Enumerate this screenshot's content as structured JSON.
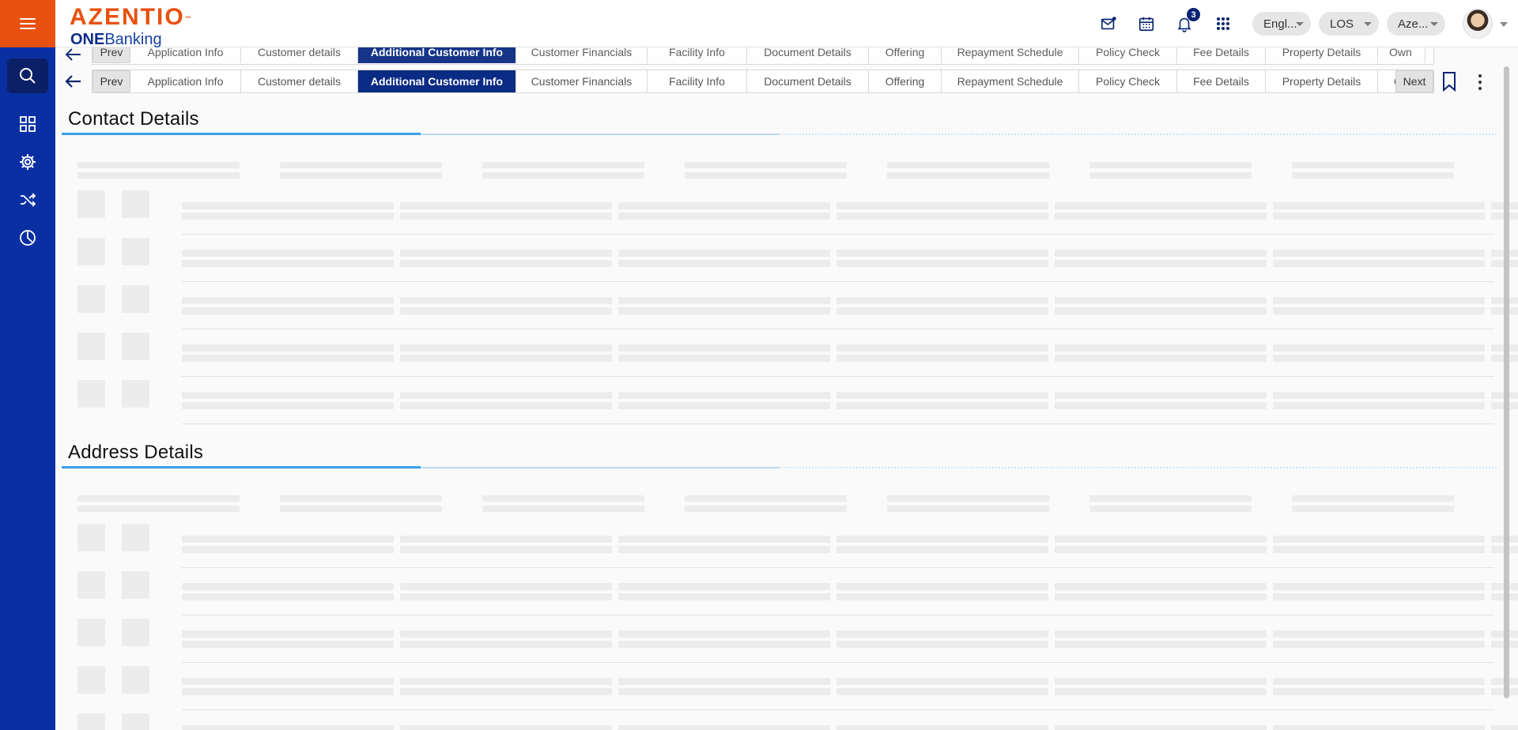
{
  "header": {
    "brand": "AZENTIO",
    "brand_tm": "™",
    "sub_bold": "ONE",
    "sub_rest": "Banking",
    "notification_count": "3",
    "pills": [
      {
        "label": "Engl..."
      },
      {
        "label": "LOS"
      },
      {
        "label": "Aze..."
      }
    ]
  },
  "sidebar": {
    "items": [
      {
        "icon": "search-icon",
        "active": true
      },
      {
        "icon": "dashboard-grid-icon",
        "active": false
      },
      {
        "icon": "settings-gear-icon",
        "active": false
      },
      {
        "icon": "shuffle-icon",
        "active": false
      },
      {
        "icon": "pie-chart-icon",
        "active": false
      }
    ]
  },
  "tabs": {
    "prev_label": "Prev",
    "next_label": "Next",
    "items": [
      {
        "label": "Application Info"
      },
      {
        "label": "Customer details"
      },
      {
        "label": "Additional Customer Info",
        "active": true
      },
      {
        "label": "Customer Financials"
      },
      {
        "label": "Facility Info"
      },
      {
        "label": "Document Details"
      },
      {
        "label": "Offering"
      },
      {
        "label": "Repayment Schedule"
      },
      {
        "label": "Policy Check"
      },
      {
        "label": "Fee Details"
      },
      {
        "label": "Property Details"
      },
      {
        "label": "Own"
      }
    ]
  },
  "sections": [
    {
      "title": "Contact Details"
    },
    {
      "title": "Address Details"
    }
  ],
  "colors": {
    "brand_orange": "#e8510f",
    "sidebar_blue": "#0a2fa3",
    "active_tab": "#0a2b84",
    "accent_line": "#3aa0e6"
  }
}
